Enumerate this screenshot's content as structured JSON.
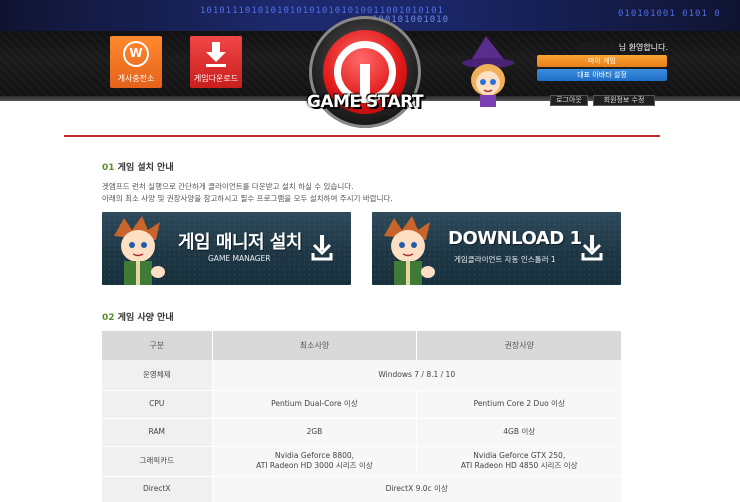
{
  "header": {
    "binary_1": "10101110101010101010101010011001010101",
    "binary_2": "100101001010",
    "binary_3": "010101001 0101 0",
    "tile_center_label": "게사충전소",
    "tile_center_letter": "W",
    "tile_download_label": "게임다운로드",
    "gamestart_label": "GAME START",
    "welcome_text": "님 환영합니다.",
    "my_game_button": "마이 게임",
    "avatar_button": "대표 아바타 설정",
    "logout_button": "로그아웃",
    "edit_info_button": "회원정보 수정",
    "colors": {
      "orange": "#e7801a",
      "blue": "#1f6fc6",
      "red": "#c81e1e",
      "accent_line": "#c82b2b"
    }
  },
  "section1": {
    "number": "01",
    "title": "게임 설치 안내",
    "desc_1": "겟앰프드 런처 실행으로 간단하게 클라이언트를 다운받고 설치 하실 수 있습니다.",
    "desc_2": "아래의 최소 사양 및 권장사양을 참고하시고 필수 프로그램을 모두 설치하여 주시기 바랍니다.",
    "banner_left_title": "게임 매니저 설치",
    "banner_left_sub": "GAME MANAGER",
    "banner_right_title": "DOWNLOAD 1",
    "banner_right_sub": "게임클라이언트 자동 인스톨러 1"
  },
  "section2": {
    "number": "02",
    "title": "게임 사양 안내",
    "columns": [
      "구분",
      "최소사양",
      "권장사양"
    ],
    "rows": [
      {
        "label": "운영체제",
        "merged": "Windows 7 / 8.1 / 10"
      },
      {
        "label": "CPU",
        "min": "Pentium Dual-Core 이상",
        "rec": "Pentium Core 2 Duo 이상"
      },
      {
        "label": "RAM",
        "min": "2GB",
        "rec": "4GB 이상"
      },
      {
        "label": "그래픽카드",
        "min_1": "Nvidia Geforce 8800,",
        "min_2": "ATI Radeon HD 3000 시리즈 이상",
        "rec_1": "Nvidia Geforce GTX 250,",
        "rec_2": "ATI Radeon HD 4850 시리즈 이상"
      },
      {
        "label": "DirectX",
        "merged": "DirectX 9.0c 이상"
      }
    ]
  }
}
